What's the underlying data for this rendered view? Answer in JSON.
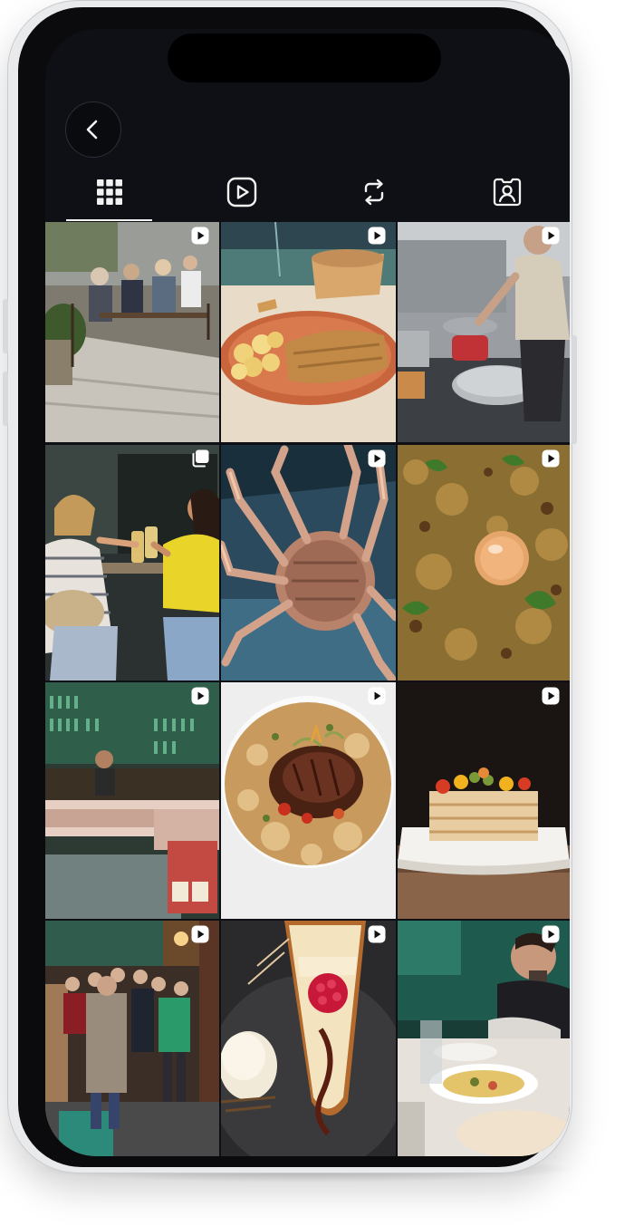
{
  "app": {
    "tabs": [
      {
        "icon": "grid-icon",
        "active": true
      },
      {
        "icon": "reels-icon",
        "active": false
      },
      {
        "icon": "repost-icon",
        "active": false
      },
      {
        "icon": "tagged-icon",
        "active": false
      }
    ],
    "back_icon": "chevron-left-icon"
  },
  "grid": {
    "posts": [
      {
        "subject": "terrace-cafe",
        "badge": "reel-icon"
      },
      {
        "subject": "schnitzel-plate",
        "badge": "reel-icon"
      },
      {
        "subject": "chef-kitchen",
        "badge": "reel-icon"
      },
      {
        "subject": "friends-toast",
        "badge": "carousel-icon"
      },
      {
        "subject": "spider-crab",
        "badge": "reel-icon"
      },
      {
        "subject": "rice-dish-yolk",
        "badge": "reel-icon"
      },
      {
        "subject": "bar-interior",
        "badge": "reel-icon"
      },
      {
        "subject": "risotto-plate",
        "badge": "reel-icon"
      },
      {
        "subject": "layered-terrine",
        "badge": "reel-icon"
      },
      {
        "subject": "crowded-bar",
        "badge": "reel-icon"
      },
      {
        "subject": "cheesecake-raspberry",
        "badge": "reel-icon"
      },
      {
        "subject": "diners-table",
        "badge": "reel-icon"
      }
    ]
  },
  "colors": {
    "screen_bg": "#0e1015",
    "icon": "#f2f2f2"
  }
}
